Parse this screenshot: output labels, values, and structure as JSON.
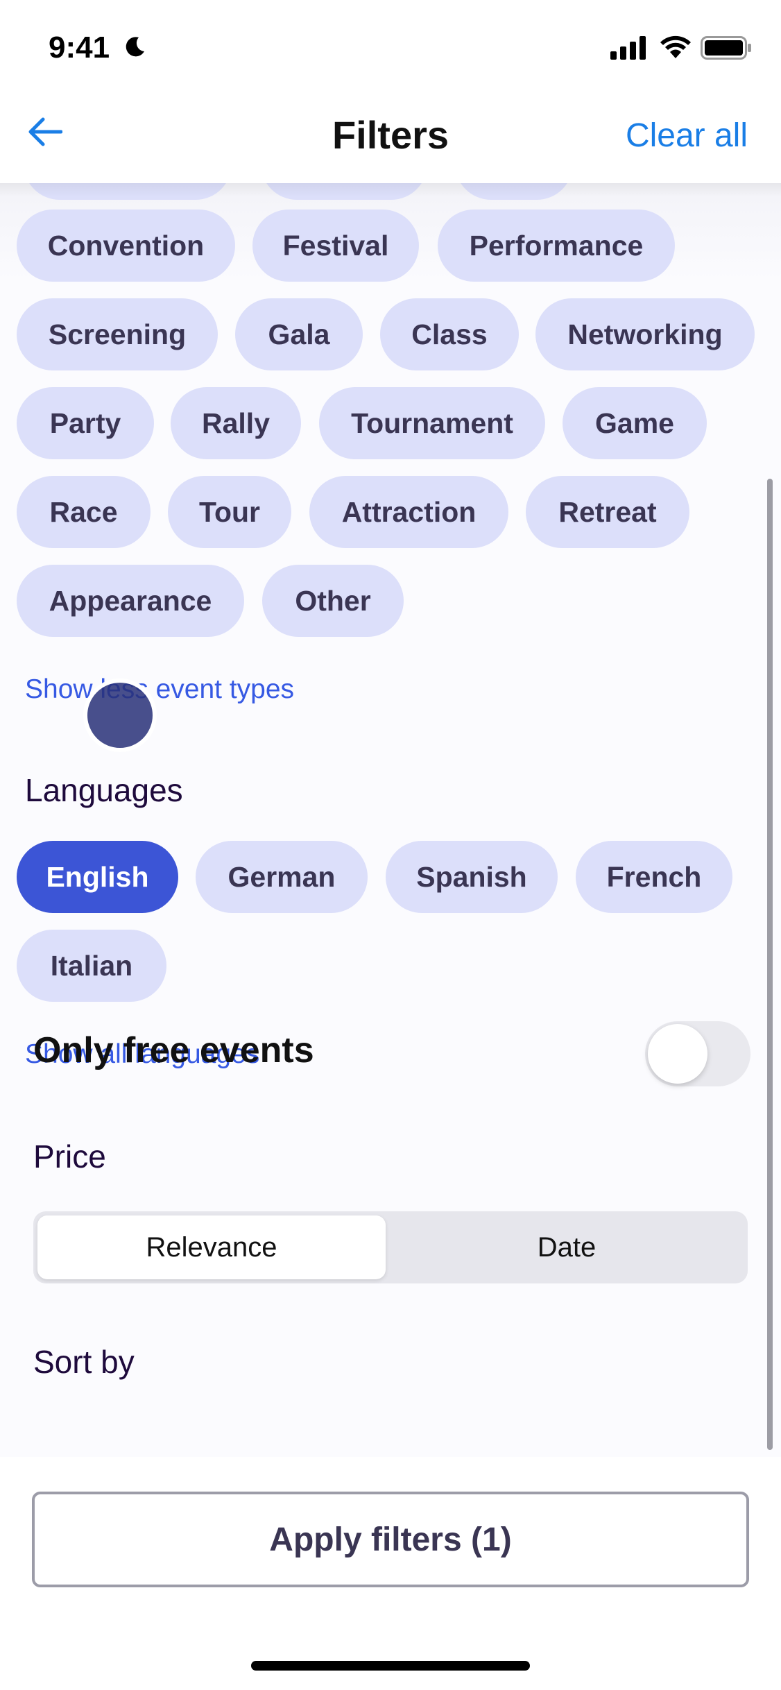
{
  "status_bar": {
    "time": "9:41"
  },
  "nav": {
    "title": "Filters",
    "clear_all": "Clear all"
  },
  "event_types": {
    "rows": [
      [
        "Convention",
        "Festival",
        "Performance"
      ],
      [
        "Screening",
        "Gala",
        "Class",
        "Networking"
      ],
      [
        "Party",
        "Rally",
        "Tournament",
        "Game"
      ],
      [
        "Race",
        "Tour",
        "Attraction",
        "Retreat"
      ],
      [
        "Appearance",
        "Other"
      ]
    ],
    "toggle_link": "Show less event types"
  },
  "languages": {
    "title": "Languages",
    "options": [
      "English",
      "German",
      "Spanish",
      "French",
      "Italian"
    ],
    "selected": "English",
    "toggle_link": "Show all languages"
  },
  "price": {
    "title": "Price",
    "free_label": "Only free events",
    "free_enabled": false
  },
  "sort": {
    "title": "Sort by",
    "options": [
      "Relevance",
      "Date"
    ],
    "selected": "Relevance"
  },
  "apply_button": "Apply filters (1)",
  "colors": {
    "accent_link": "#1a7ee6",
    "chip_bg": "#dcdffa",
    "chip_selected": "#3c55d6",
    "text_link": "#3659e3"
  }
}
